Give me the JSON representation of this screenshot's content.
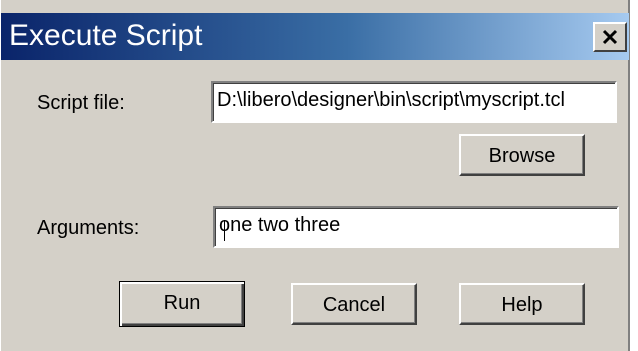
{
  "window": {
    "title": "Execute Script",
    "close_icon": "close-icon"
  },
  "script_file": {
    "label": "Script file:",
    "value": "D:\\libero\\designer\\bin\\script\\myscript.tcl"
  },
  "browse_button": {
    "label": "Browse"
  },
  "arguments": {
    "label": "Arguments:",
    "value": "one two three"
  },
  "buttons": {
    "run": "Run",
    "cancel": "Cancel",
    "help": "Help"
  },
  "colors": {
    "titlebar_start": "#0a246a",
    "titlebar_end": "#a6caf0",
    "face": "#d4d0c8"
  }
}
